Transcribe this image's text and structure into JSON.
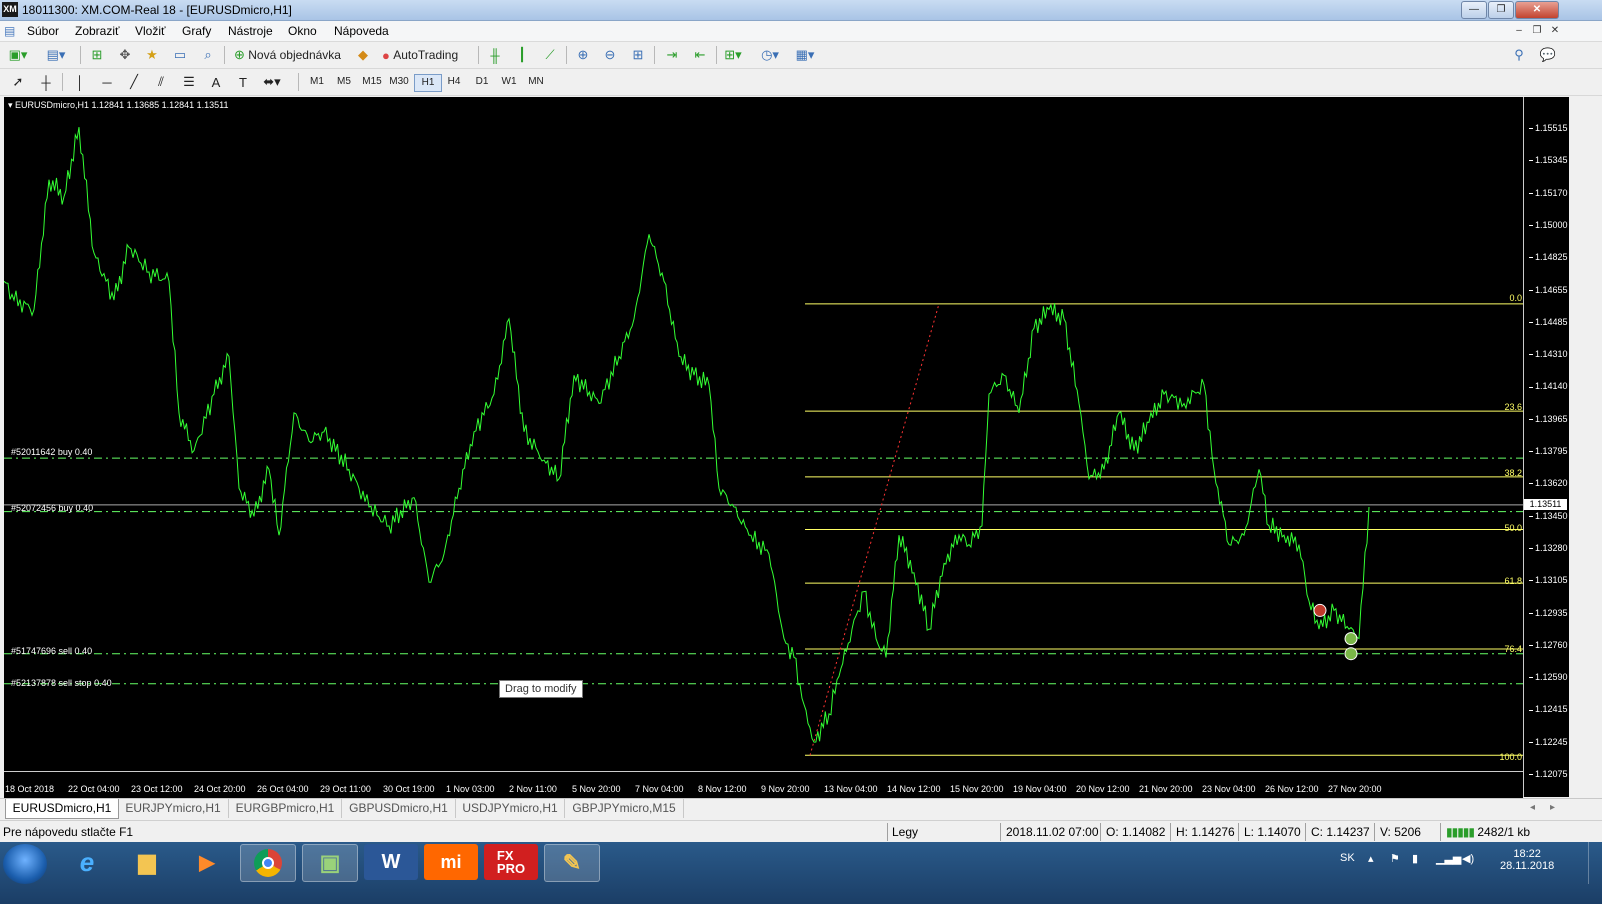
{
  "window": {
    "title": "18011300: XM.COM-Real 18 - [EURUSDmicro,H1]",
    "logo": "XM",
    "buttons": [
      "minimize",
      "maximize",
      "close"
    ]
  },
  "menu": [
    "Súbor",
    "Zobraziť",
    "Vložiť",
    "Grafy",
    "Nástroje",
    "Okno",
    "Nápoveda"
  ],
  "toolbar1": {
    "new_order_label": "Nová objednávka",
    "autotrading_label": "AutoTrading"
  },
  "timeframes": [
    "M1",
    "M5",
    "M15",
    "M30",
    "H1",
    "H4",
    "D1",
    "W1",
    "MN"
  ],
  "active_timeframe": "H1",
  "chart": {
    "info": "EURUSDmicro,H1  1.12841 1.13685 1.12841 1.13511",
    "current_price": "1.13511",
    "price_labels": [
      "1.15515",
      "1.15345",
      "1.15170",
      "1.15000",
      "1.14825",
      "1.14655",
      "1.14485",
      "1.14310",
      "1.14140",
      "1.13965",
      "1.13795",
      "1.13620",
      "1.13450",
      "1.13280",
      "1.13105",
      "1.12935",
      "1.12760",
      "1.12590",
      "1.12415",
      "1.12245",
      "1.12075"
    ],
    "time_labels": [
      "18 Oct 2018",
      "22 Oct 04:00",
      "23 Oct 12:00",
      "24 Oct 20:00",
      "26 Oct 04:00",
      "29 Oct 11:00",
      "30 Oct 19:00",
      "1 Nov 03:00",
      "2 Nov 11:00",
      "5 Nov 20:00",
      "7 Nov 04:00",
      "8 Nov 12:00",
      "9 Nov 20:00",
      "13 Nov 04:00",
      "14 Nov 12:00",
      "15 Nov 20:00",
      "19 Nov 04:00",
      "20 Nov 12:00",
      "21 Nov 20:00",
      "23 Nov 04:00",
      "26 Nov 12:00",
      "27 Nov 20:00"
    ],
    "orders": [
      {
        "label": "#52011642 buy 0.40",
        "price": 1.1376
      },
      {
        "label": "#52072456 buy 0.40",
        "price": 1.13475
      },
      {
        "label": "#51747696 sell 0.40",
        "price": 1.1272
      },
      {
        "label": "#52137878 sell stop 0.40",
        "price": 1.1256
      }
    ],
    "fibonacci": [
      {
        "level": "0.0",
        "price": 1.1458
      },
      {
        "level": "23.6",
        "price": 1.1401
      },
      {
        "level": "38.2",
        "price": 1.1366
      },
      {
        "level": "50.0",
        "price": 1.1338
      },
      {
        "level": "61.8",
        "price": 1.13095
      },
      {
        "level": "76.4",
        "price": 1.12745
      },
      {
        "level": "100.0",
        "price": 1.1218
      }
    ],
    "tooltip": "Drag to modify",
    "colors": {
      "background": "#000000",
      "line": "#33ff33",
      "fib": "#ffff66",
      "order": "#66ff66",
      "trendline": "#ff3333"
    }
  },
  "tabs": [
    "EURUSDmicro,H1",
    "EURJPYmicro,H1",
    "EURGBPmicro,H1",
    "GBPUSDmicro,H1",
    "USDJPYmicro,H1",
    "GBPJPYmicro,M15"
  ],
  "status": {
    "help": "Pre nápovedu stlačte F1",
    "profile": "Legy",
    "datetime": "2018.11.02 07:00",
    "open": "O: 1.14082",
    "high": "H: 1.14276",
    "low": "L: 1.14070",
    "close": "C: 1.14237",
    "volume": "V: 5206",
    "traffic": "2482/1 kb"
  },
  "taskbar": {
    "apps": [
      "internet-explorer",
      "file-explorer",
      "media-player",
      "chrome",
      "metatrader",
      "word",
      "mi",
      "fxpro",
      "paint"
    ],
    "language": "SK",
    "time": "18:22",
    "date": "28.11.2018"
  }
}
